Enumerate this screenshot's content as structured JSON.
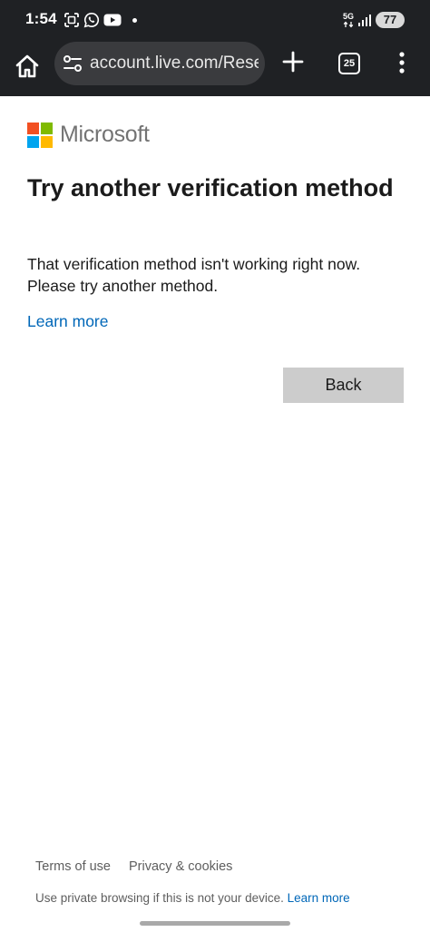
{
  "status_bar": {
    "time": "1:54",
    "network": "5G",
    "battery": "77"
  },
  "browser": {
    "url": "account.live.com/ResetPassword",
    "tab_count": "25"
  },
  "page": {
    "brand": "Microsoft",
    "title": "Try another verification method",
    "description": "That verification method isn't working right now. Please try another method.",
    "learn_more": "Learn more",
    "back_button": "Back"
  },
  "footer": {
    "terms": "Terms of use",
    "privacy": "Privacy & cookies",
    "private_note": "Use private browsing if this is not your device.",
    "learn_more": "Learn more"
  },
  "colors": {
    "status_bg": "#1f2124",
    "link": "#0067b8",
    "button_bg": "#cccccc",
    "ms_red": "#f25022",
    "ms_green": "#7fba00",
    "ms_blue": "#00a4ef",
    "ms_yellow": "#ffb900"
  },
  "icons": {
    "status_left": [
      "screenshot-icon",
      "whatsapp-icon",
      "youtube-icon",
      "notification-dot-icon"
    ],
    "status_right": [
      "network-5g-icon",
      "signal-icon",
      "battery-icon"
    ],
    "toolbar": [
      "home-icon",
      "site-settings-icon",
      "new-tab-icon",
      "tab-switcher-icon",
      "more-menu-icon"
    ]
  }
}
